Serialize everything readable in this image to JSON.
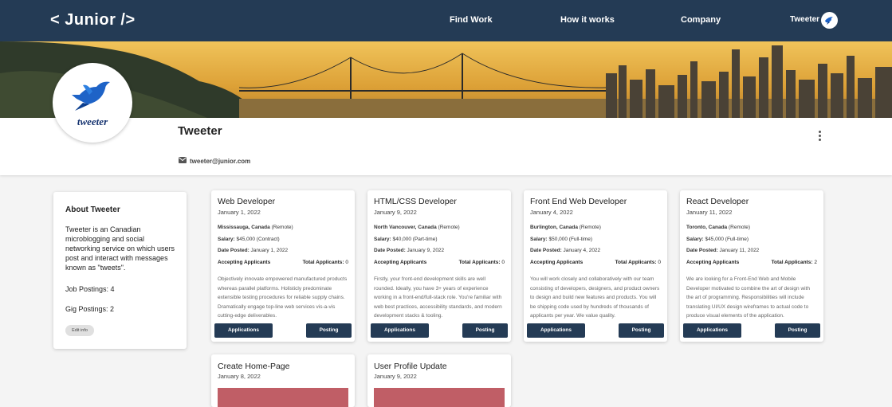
{
  "nav": {
    "logo": "< Junior />",
    "links": [
      "Find Work",
      "How it works",
      "Company"
    ],
    "user_name": "Tweeter"
  },
  "company": {
    "name": "Tweeter",
    "logo_text": "tweeter",
    "email": "tweeter@junior.com"
  },
  "about": {
    "title": "About Tweeter",
    "description": "Tweeter is an Canadian microblogging and social networking service on which users post and interact with messages known as \"tweets\".",
    "job_postings": "Job Postings: 4",
    "gig_postings": "Gig Postings: 2",
    "edit_label": "Edit info"
  },
  "jobs": [
    {
      "title": "Web Developer",
      "date": "January 1, 2022",
      "location": "Mississauga, Canada",
      "remote": "(Remote)",
      "salary_label": "Salary:",
      "salary": "$45,000 (Contract)",
      "posted_label": "Date Posted:",
      "posted": "January 1, 2022",
      "status": "Accepting Applicants",
      "total_label": "Total Applicants:",
      "total": "0",
      "description": "Objectively innovate empowered manufactured products whereas parallel platforms. Holisticly predominate extensible testing procedures for reliable supply chains. Dramatically engage top-line web services vis-a-vis cutting-edge deliverables.",
      "applications_label": "Applications",
      "posting_label": "Posting"
    },
    {
      "title": "HTML/CSS Developer",
      "date": "January 9, 2022",
      "location": "North Vancouver, Canada",
      "remote": "(Remote)",
      "salary_label": "Salary:",
      "salary": "$40,000 (Part-time)",
      "posted_label": "Date Posted:",
      "posted": "January 9, 2022",
      "status": "Accepting Applicants",
      "total_label": "Total Applicants:",
      "total": "0",
      "description": "Firstly, your front-end development skills are well rounded. Ideally, you have 3+ years of experience working in a front-end/full-stack role. You're familiar with web best practices, accessibility standards, and modern development stacks & tooling.",
      "applications_label": "Applications",
      "posting_label": "Posting"
    },
    {
      "title": "Front End Web Developer",
      "date": "January 4, 2022",
      "location": "Burlington, Canada",
      "remote": "(Remote)",
      "salary_label": "Salary:",
      "salary": "$50,000 (Full-time)",
      "posted_label": "Date Posted:",
      "posted": "January 4, 2022",
      "status": "Accepting Applicants",
      "total_label": "Total Applicants:",
      "total": "0",
      "description": "You will work closely and collaboratively with our team consisting of developers, designers, and product owners to design and build new features and products. You will be shipping code used by hundreds of thousands of applicants per year. We value quality.",
      "applications_label": "Applications",
      "posting_label": "Posting"
    },
    {
      "title": "React Developer",
      "date": "January 11, 2022",
      "location": "Toronto, Canada",
      "remote": "(Remote)",
      "salary_label": "Salary:",
      "salary": "$45,000 (Full-time)",
      "posted_label": "Date Posted:",
      "posted": "January 11, 2022",
      "status": "Accepting Applicants",
      "total_label": "Total Applicants:",
      "total": "2",
      "description": "We are looking for a Front-End Web and Mobile Developer motivated to combine the art of design with the art of programming. Responsibilities will include translating UI/UX design wireframes to actual code to produce visual elements of the application.",
      "applications_label": "Applications",
      "posting_label": "Posting"
    }
  ],
  "gigs": [
    {
      "title": "Create Home-Page",
      "date": "January 8, 2022"
    },
    {
      "title": "User Profile Update",
      "date": "January 9, 2022"
    }
  ],
  "colors": {
    "nav": "#243b55",
    "button": "#243b55",
    "gig_accent": "#c05e66"
  }
}
